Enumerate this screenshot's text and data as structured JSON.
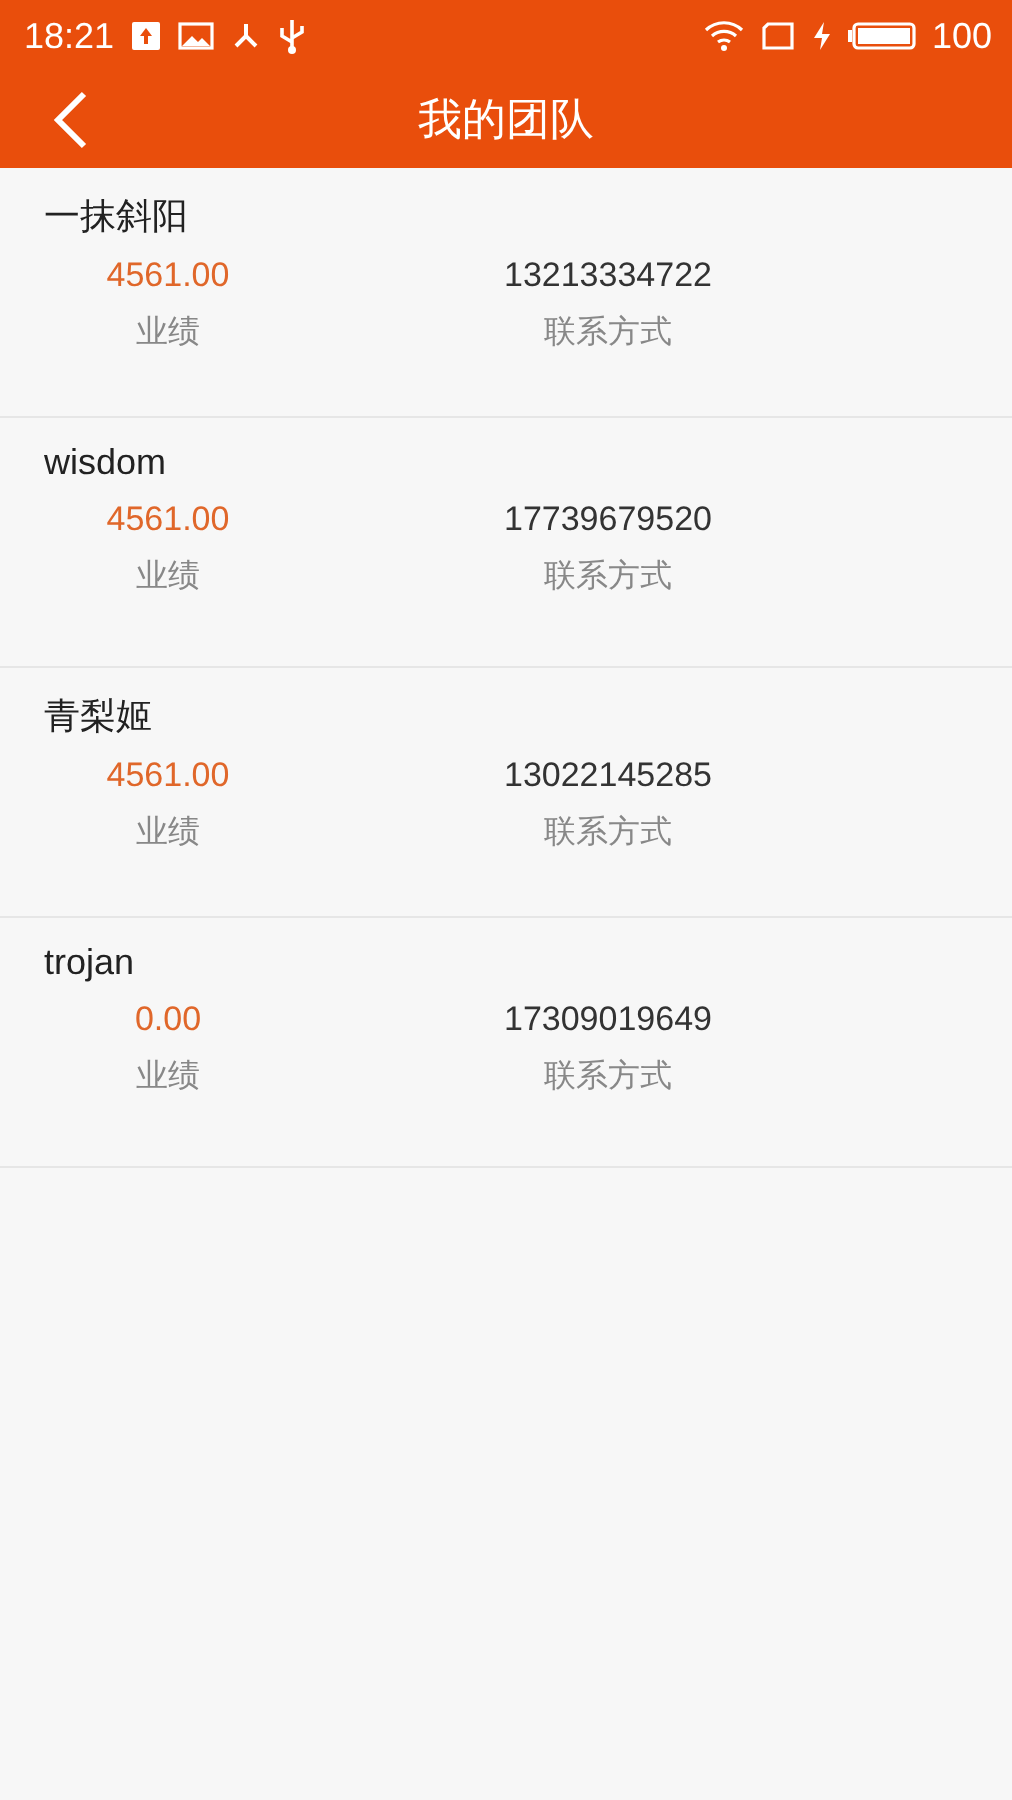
{
  "status_bar": {
    "time": "18:21",
    "battery": "100"
  },
  "header": {
    "title": "我的团队"
  },
  "members": [
    {
      "name": "一抹斜阳",
      "performance": "4561.00",
      "performance_label": "业绩",
      "phone": "13213334722",
      "phone_label": "联系方式"
    },
    {
      "name": "wisdom",
      "performance": "4561.00",
      "performance_label": "业绩",
      "phone": "17739679520",
      "phone_label": "联系方式"
    },
    {
      "name": "青梨姬",
      "performance": "4561.00",
      "performance_label": "业绩",
      "phone": "13022145285",
      "phone_label": "联系方式"
    },
    {
      "name": "trojan",
      "performance": "0.00",
      "performance_label": "业绩",
      "phone": "17309019649",
      "phone_label": "联系方式"
    }
  ]
}
